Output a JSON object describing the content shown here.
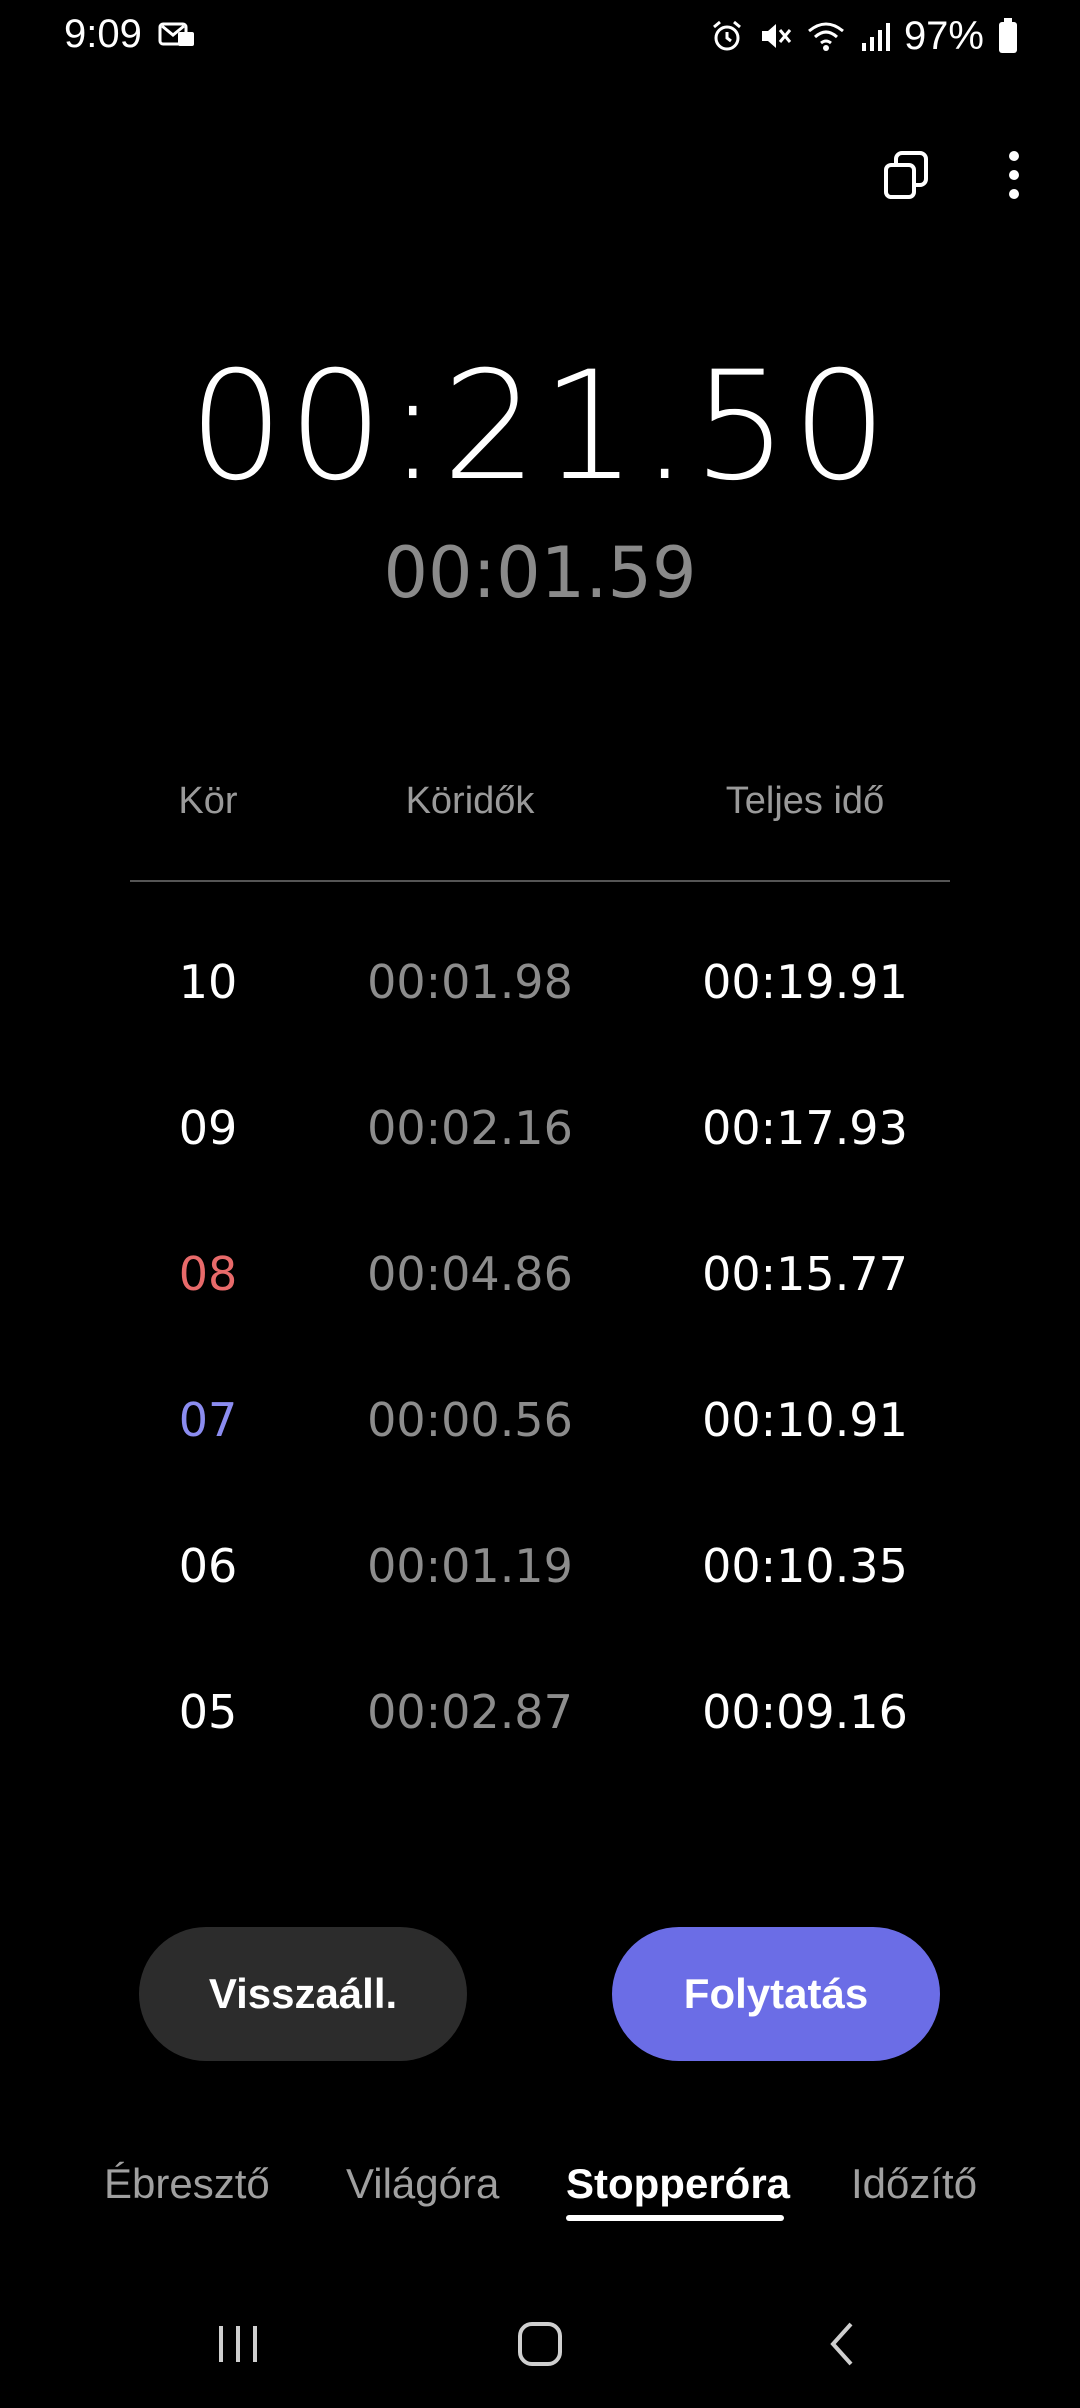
{
  "status_bar": {
    "time": "9:09",
    "battery": "97%",
    "icons": [
      "message-icon",
      "alarm-icon",
      "mute-icon",
      "wifi-icon",
      "signal-icon",
      "battery-icon"
    ]
  },
  "top_actions": {
    "icons": [
      "popup-window-icon",
      "more-options-icon"
    ]
  },
  "stopwatch": {
    "main_time": "00:21.50",
    "lap_time": "00:01.59"
  },
  "lap_table": {
    "headers": {
      "lap": "Kör",
      "split": "Köridők",
      "total": "Teljes idő"
    },
    "rows": [
      {
        "lap": "10",
        "split": "00:01.98",
        "total": "00:19.91",
        "highlight": "none"
      },
      {
        "lap": "09",
        "split": "00:02.16",
        "total": "00:17.93",
        "highlight": "none"
      },
      {
        "lap": "08",
        "split": "00:04.86",
        "total": "00:15.77",
        "highlight": "slowest"
      },
      {
        "lap": "07",
        "split": "00:00.56",
        "total": "00:10.91",
        "highlight": "fastest"
      },
      {
        "lap": "06",
        "split": "00:01.19",
        "total": "00:10.35",
        "highlight": "none"
      },
      {
        "lap": "05",
        "split": "00:02.87",
        "total": "00:09.16",
        "highlight": "none"
      }
    ]
  },
  "buttons": {
    "reset": "Visszaáll.",
    "resume": "Folytatás"
  },
  "tabs": [
    {
      "label": "Ébresztő",
      "active": false
    },
    {
      "label": "Világóra",
      "active": false
    },
    {
      "label": "Stopperóra",
      "active": true
    },
    {
      "label": "Időzítő",
      "active": false
    }
  ],
  "colors": {
    "accent": "#6b6de6",
    "slowest": "#e86a6a",
    "fastest": "#8b8cf0",
    "background": "#000000"
  },
  "nav_bar": {
    "icons": [
      "recent-apps-icon",
      "home-icon",
      "back-icon"
    ]
  }
}
